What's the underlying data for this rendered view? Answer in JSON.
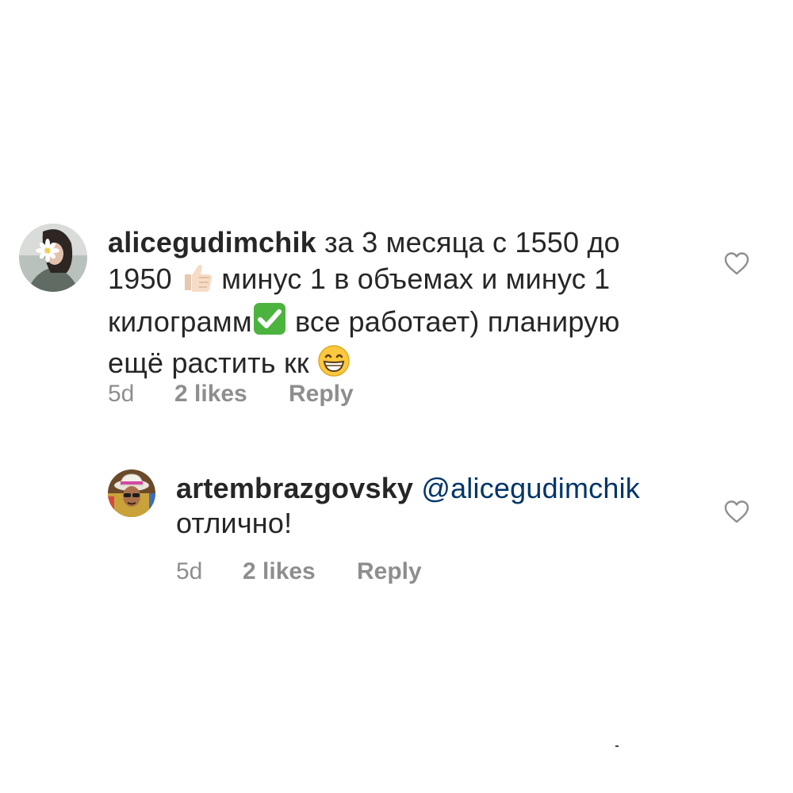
{
  "comments": [
    {
      "username": "alicegudimchik",
      "text_1": " за 3 месяца с 1550 до",
      "text_2": "1950 ",
      "text_3": " минус 1 в объемах и минус 1",
      "text_4": "килограмм",
      "text_5": " все работает) планирую",
      "text_6": "ещё растить кк ",
      "emoji_thumbs": "thumbs-up-light-skin",
      "emoji_check": "check-mark-button",
      "emoji_grin": "grinning-face",
      "time": "5d",
      "likes": "2 likes",
      "reply": "Reply",
      "heart_icon": "heart-outline-icon"
    },
    {
      "username": "artembrazgovsky",
      "mention": "@alicegudimchik",
      "text_1": "отлично!",
      "time": "5d",
      "likes": "2 likes",
      "reply": "Reply",
      "heart_icon": "heart-outline-icon"
    }
  ],
  "colors": {
    "text": "#262626",
    "meta": "#8e8e8e",
    "mention": "#003569",
    "check_green": "#4cb33f"
  }
}
